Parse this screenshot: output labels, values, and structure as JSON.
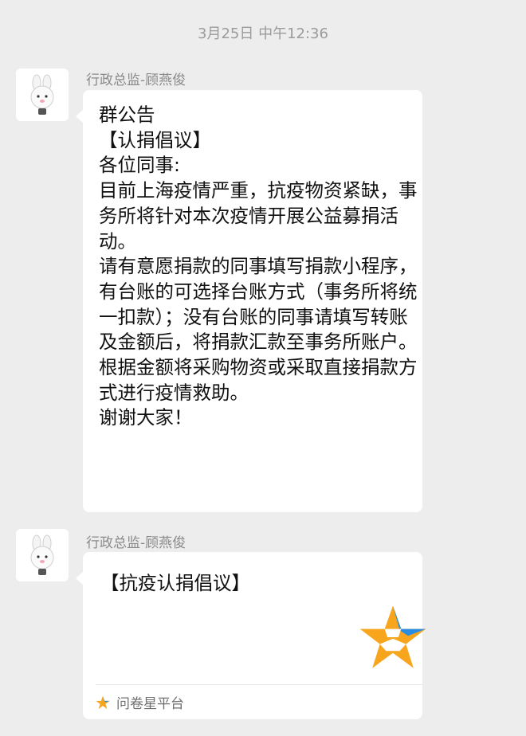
{
  "timestamp": "3月25日 中午12:36",
  "messages": [
    {
      "sender": "行政总监-顾燕俊",
      "avatar_icon": "cartoon-bunny-avatar-icon",
      "lines": [
        "群公告",
        "【认捐倡议】",
        "各位同事:",
        "目前上海疫情严重，抗疫物资紧缺，事务所将针对本次疫情开展公益募捐活动。",
        "请有意愿捐款的同事填写捐款小程序，有台账的可选择台账方式（事务所将统一扣款）；没有台账的同事请填写转账及金额后，将捐款汇款至事务所账户。",
        "根据金额将采购物资或采取直接捐款方式进行疫情救助。",
        "谢谢大家！"
      ]
    },
    {
      "sender": "行政总监-顾燕俊",
      "avatar_icon": "cartoon-bunny-avatar-icon",
      "card": {
        "title": "【抗疫认捐倡议】",
        "logo_icon": "wenjuanxing-star-logo-icon",
        "source": "问卷星平台",
        "source_icon": "small-star-icon"
      }
    }
  ],
  "colors": {
    "background": "#ededed",
    "bubble": "#ffffff",
    "star_orange": "#f7a51c",
    "star_blue": "#2b8de0"
  }
}
